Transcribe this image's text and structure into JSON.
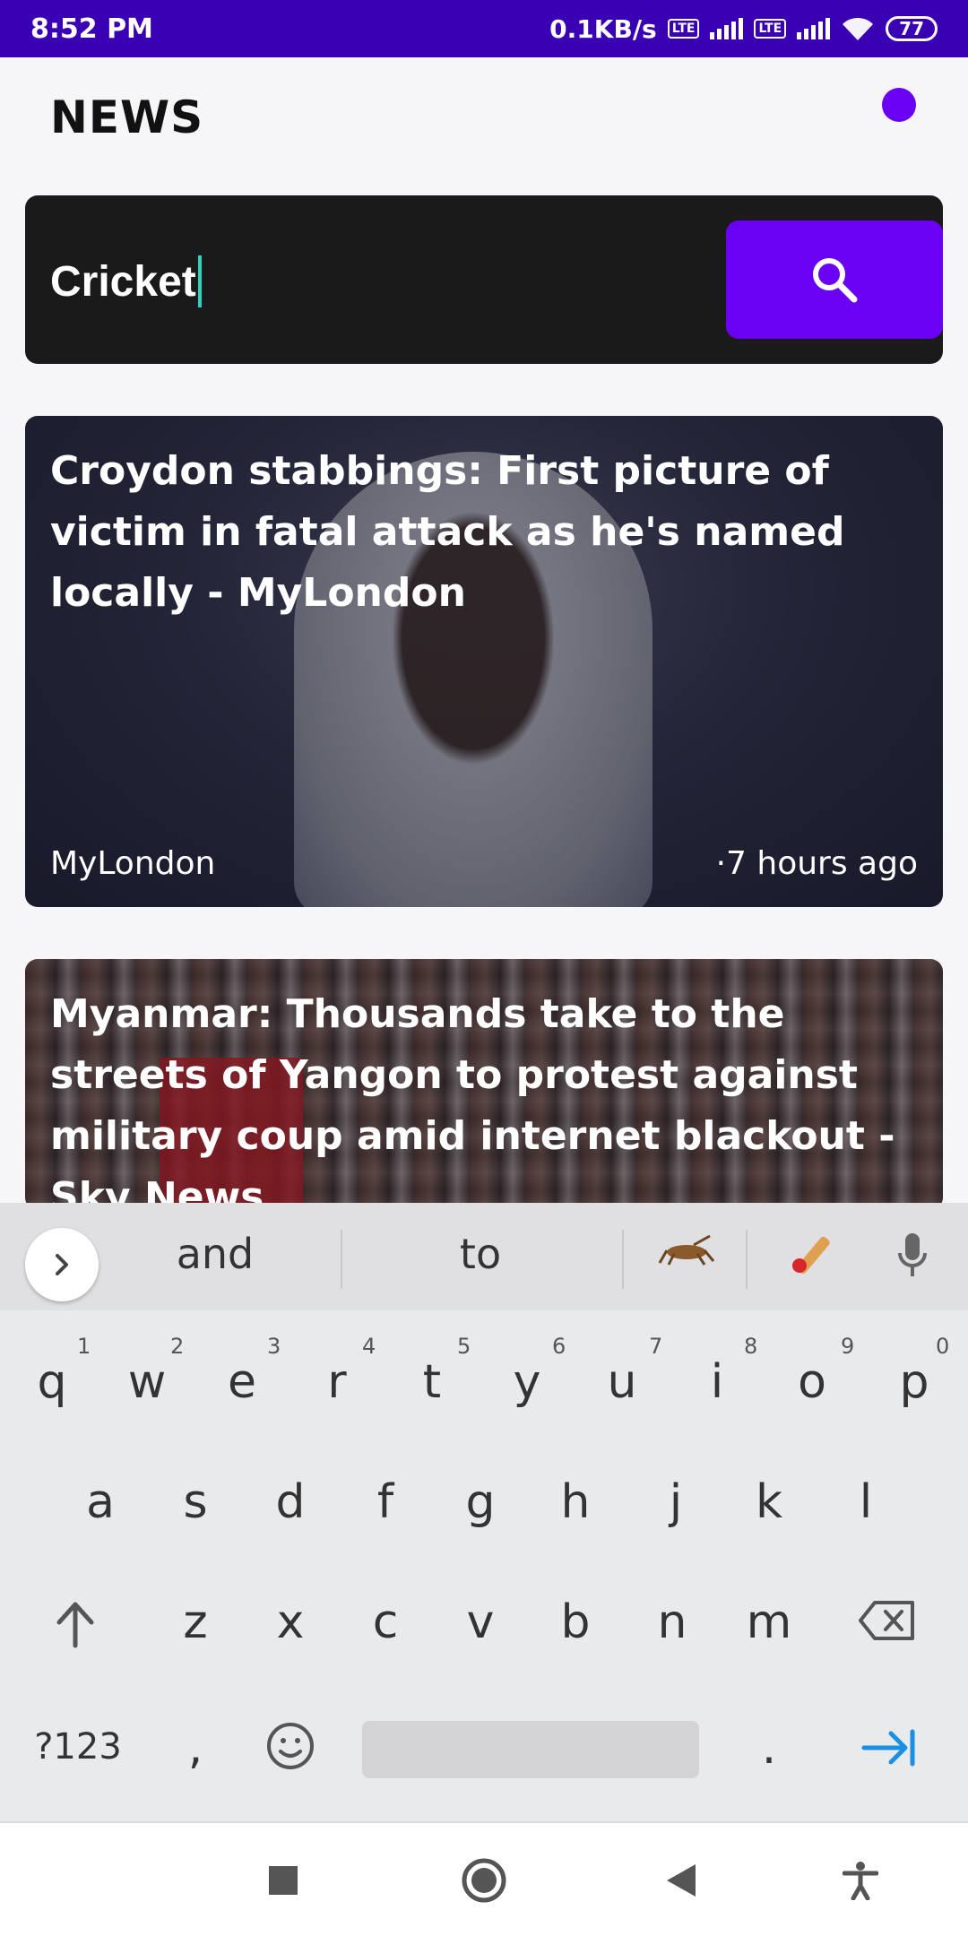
{
  "status_bar": {
    "time": "8:52 PM",
    "net_speed": "0.1KB/s",
    "lte_label": "Vo LTE",
    "battery": "77"
  },
  "header": {
    "title": "NEWS"
  },
  "search": {
    "value": "Cricket",
    "button_icon": "search-icon"
  },
  "articles": [
    {
      "title": "Croydon stabbings: First picture of victim in fatal attack as he's named locally - MyLondon",
      "source": "MyLondon",
      "time": "·7 hours ago"
    },
    {
      "title": "Myanmar: Thousands take to the streets of Yangon to protest against military coup amid internet blackout - Sky News",
      "source": "",
      "time": ""
    }
  ],
  "keyboard": {
    "suggestions": [
      "and",
      "to"
    ],
    "emoji_suggestions": [
      "cricket-insect-emoji",
      "cricket-bat-emoji"
    ],
    "row1": [
      "q",
      "w",
      "e",
      "r",
      "t",
      "y",
      "u",
      "i",
      "o",
      "p"
    ],
    "row1_hints": [
      "1",
      "2",
      "3",
      "4",
      "5",
      "6",
      "7",
      "8",
      "9",
      "0"
    ],
    "row2": [
      "a",
      "s",
      "d",
      "f",
      "g",
      "h",
      "j",
      "k",
      "l"
    ],
    "row3": [
      "z",
      "x",
      "c",
      "v",
      "b",
      "n",
      "m"
    ],
    "symbols_key": "?123",
    "comma": ",",
    "period": "."
  },
  "colors": {
    "accent": "#6a00f4",
    "status_bar": "#3a00b3",
    "search_bg": "#1a1a1a",
    "enter_key": "#1a8fe3"
  }
}
